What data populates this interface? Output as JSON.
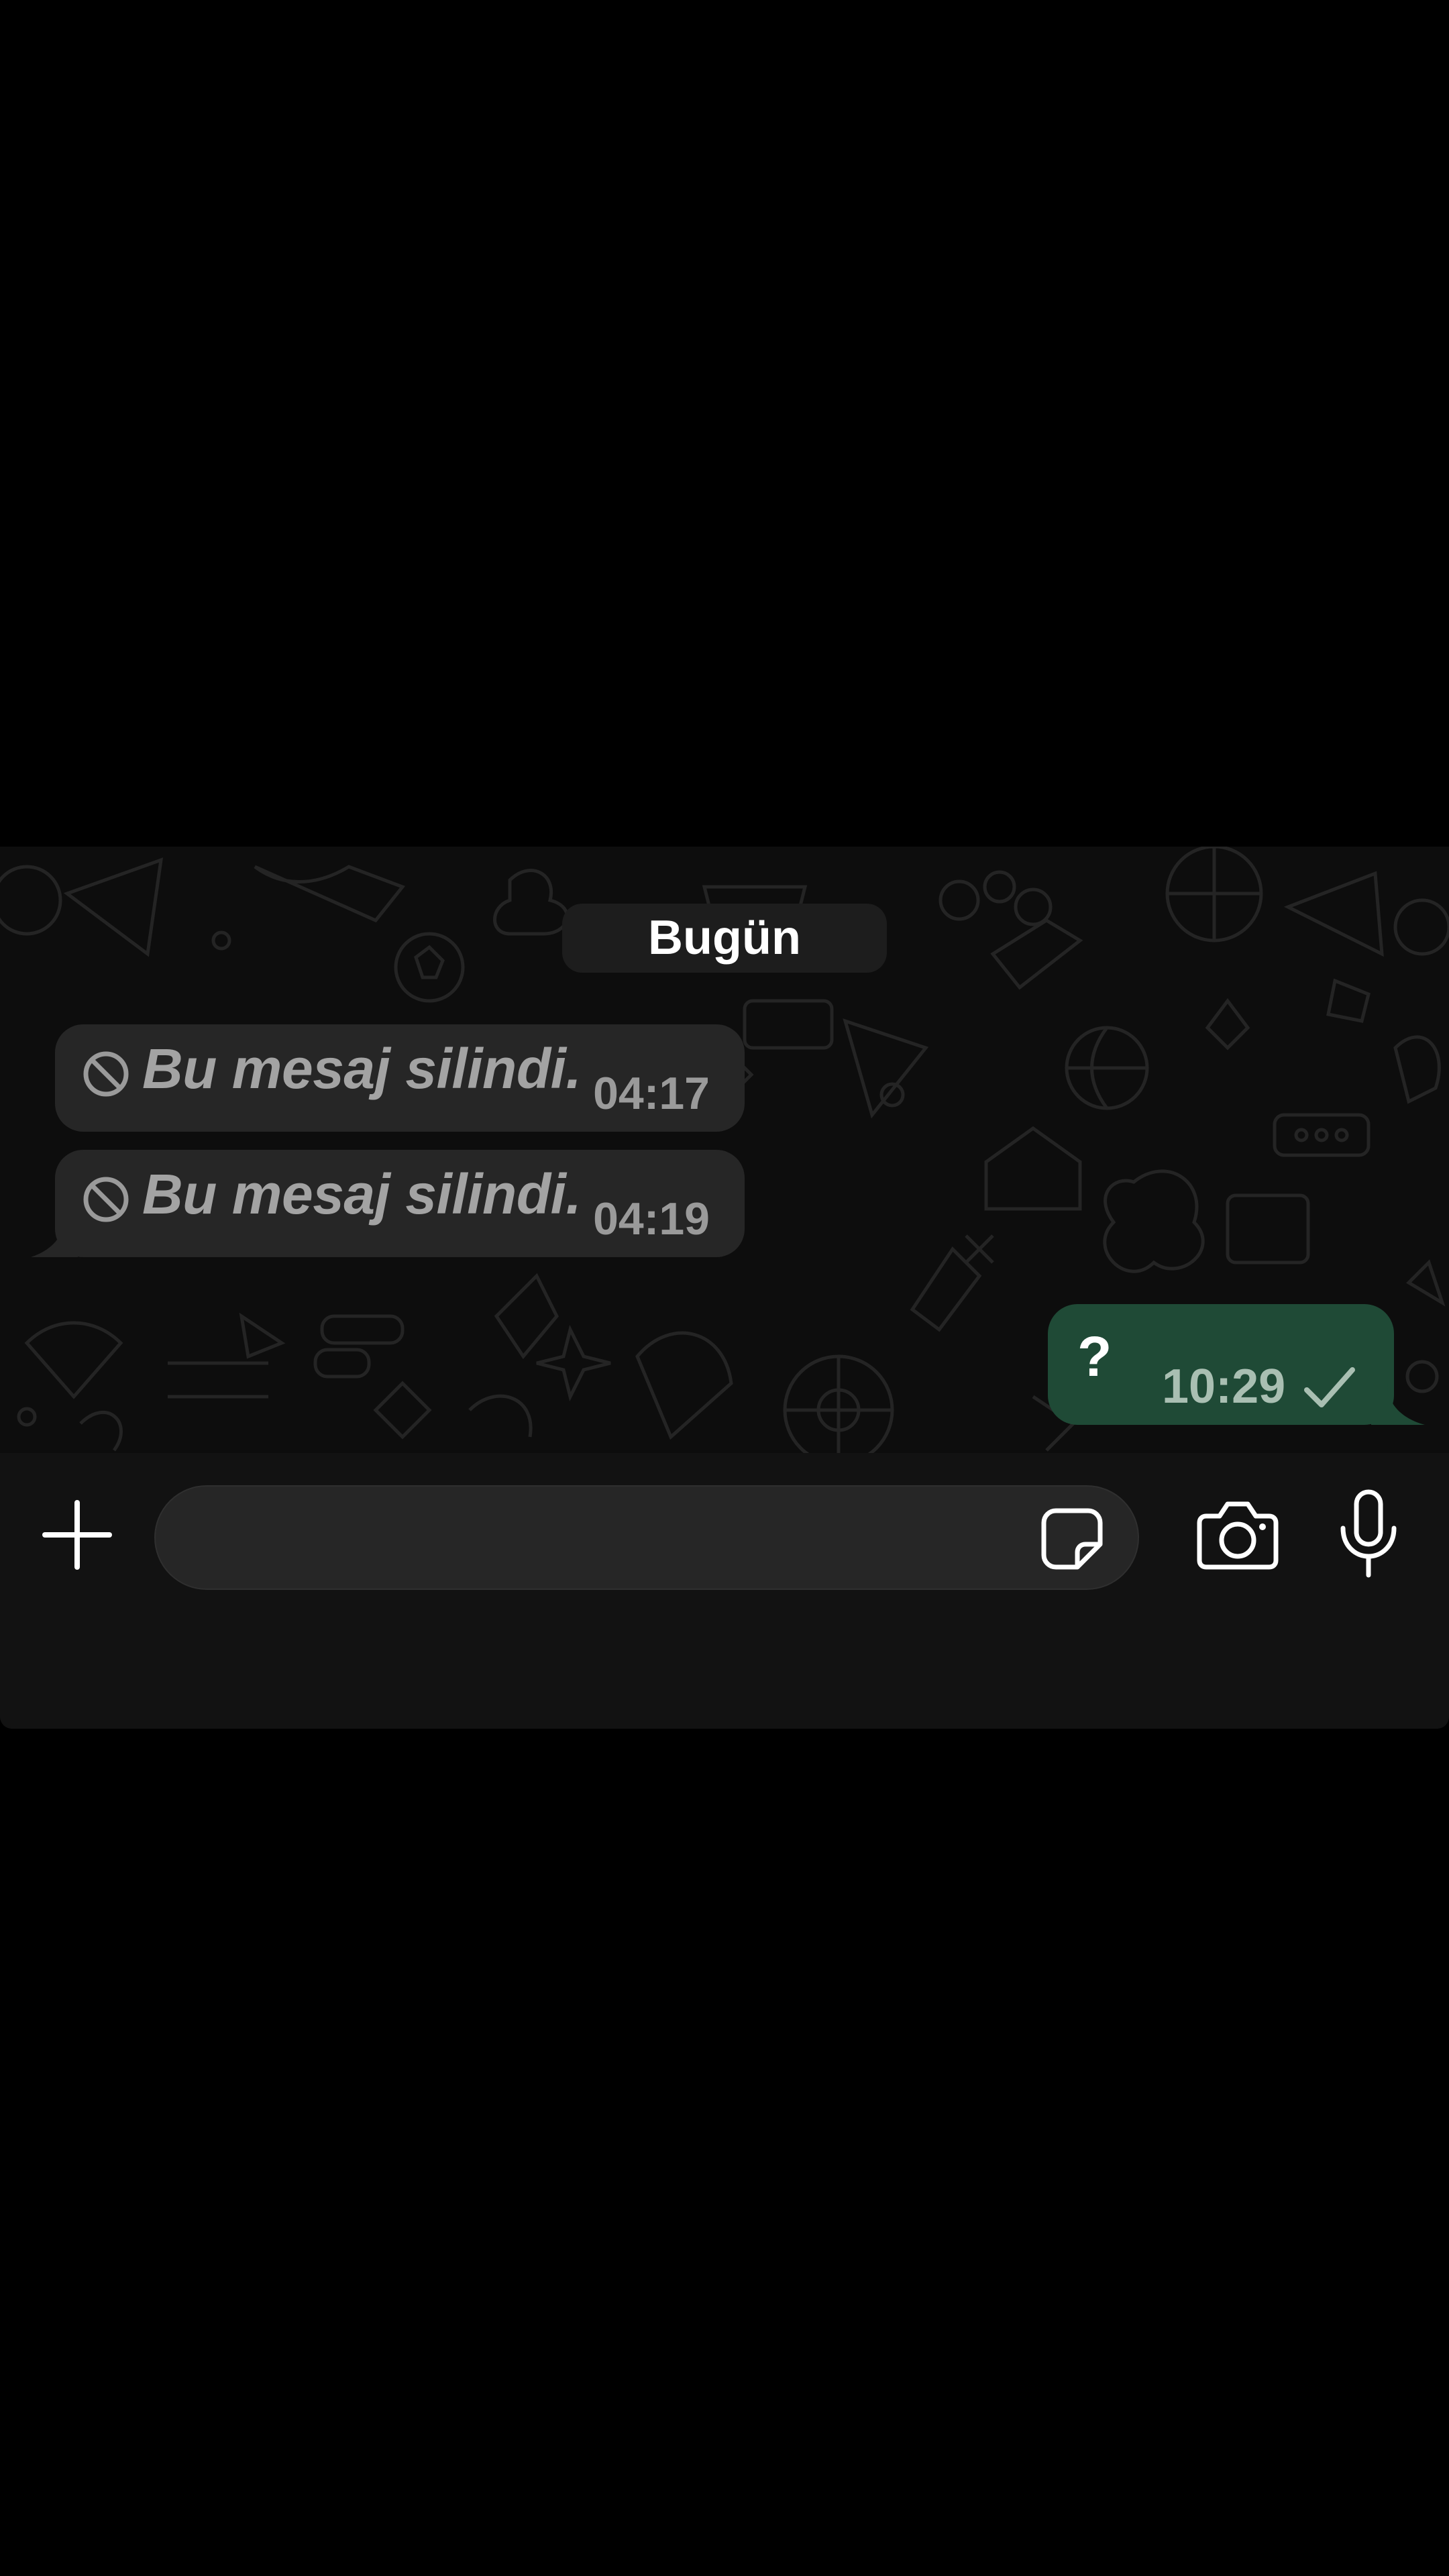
{
  "chat": {
    "date_separator": "Bugün",
    "messages": [
      {
        "direction": "incoming",
        "text": "Bu mesaj silindi.",
        "time": "04:17",
        "deleted": true
      },
      {
        "direction": "incoming",
        "text": "Bu mesaj silindi.",
        "time": "04:19",
        "deleted": true
      },
      {
        "direction": "outgoing",
        "text": "?",
        "time": "10:29",
        "status": "sent-single-check"
      }
    ]
  },
  "composer": {
    "value": "",
    "placeholder": "",
    "icons": [
      "plus-icon",
      "sticker-icon",
      "camera-icon",
      "microphone-icon"
    ]
  },
  "colors": {
    "incoming_bubble": "#262626",
    "outgoing_bubble": "#1f4a36",
    "background": "#0d0d0d",
    "input_bar": "#121212"
  }
}
